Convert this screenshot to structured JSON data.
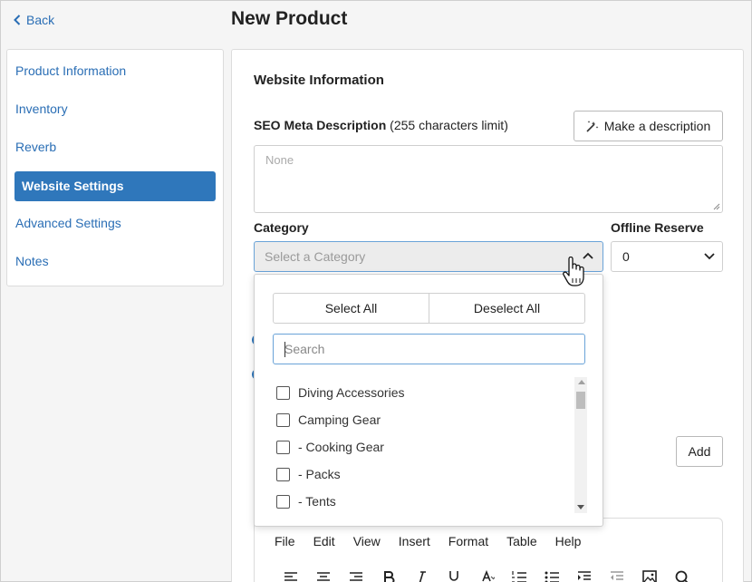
{
  "header": {
    "back_label": "Back",
    "page_title": "New Product"
  },
  "sidebar": {
    "items": [
      {
        "label": "Product Information",
        "active": false
      },
      {
        "label": "Inventory",
        "active": false
      },
      {
        "label": "Reverb",
        "active": false
      },
      {
        "label": "Website Settings",
        "active": true
      },
      {
        "label": "Advanced Settings",
        "active": false
      },
      {
        "label": "Notes",
        "active": false
      }
    ]
  },
  "main": {
    "section_title": "Website Information",
    "seo": {
      "label_bold": "SEO Meta Description",
      "label_note": " (255 characters limit)",
      "make_button": "Make a description",
      "placeholder": "None"
    },
    "category": {
      "label": "Category",
      "placeholder": "Select a Category"
    },
    "offline_reserve": {
      "label": "Offline Reserve",
      "value": "0"
    },
    "add_button": "Add",
    "editor_menu": [
      "File",
      "Edit",
      "View",
      "Insert",
      "Format",
      "Table",
      "Help"
    ]
  },
  "dropdown": {
    "select_all": "Select All",
    "deselect_all": "Deselect All",
    "search_placeholder": "Search",
    "options": [
      "Diving Accessories",
      "Camping Gear",
      "- Cooking Gear",
      "- Packs",
      "- Tents"
    ]
  },
  "colors": {
    "accent": "#2f77bb",
    "link": "#2a6eb5"
  }
}
